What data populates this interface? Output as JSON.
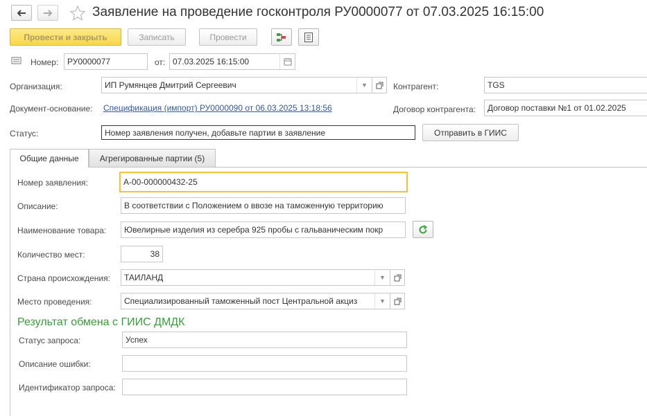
{
  "window": {
    "title": "Заявление на проведение госконтроля РУ0000077 от 07.03.2025 16:15:00"
  },
  "toolbar": {
    "post_close_label": "Провести и закрыть",
    "save_label": "Записать",
    "post_label": "Провести"
  },
  "header": {
    "number_label": "Номер:",
    "number_value": "РУ0000077",
    "date_label": "от:",
    "date_value": "07.03.2025 16:15:00",
    "org_label": "Организация:",
    "org_value": "ИП Румянцев Дмитрий Сергеевич",
    "contractor_label": "Контрагент:",
    "contractor_value": "TGS",
    "basis_label": "Документ-основание:",
    "basis_link": "Спецификация (импорт) РУ0000090 от 06.03.2025 13:18:56",
    "contract_label": "Договор контрагента:",
    "contract_value": "Договор поставки №1 от 01.02.2025",
    "status_label": "Статус:",
    "status_value": "Номер заявления получен, добавьте партии в заявление",
    "send_gis_label": "Отправить в ГИИС"
  },
  "tabs": [
    {
      "label": "Общие данные",
      "active": true
    },
    {
      "label": "Агрегированные партии (5)",
      "active": false
    }
  ],
  "general": {
    "app_number_label": "Номер заявления:",
    "app_number_value": "А-00-000000432-25",
    "description_label": "Описание:",
    "description_value": "В соответствии с Положением о ввозе на таможенную территорию",
    "goods_label": "Наименование товара:",
    "goods_value": "Ювелирные изделия из серебра 925 пробы с гальваническим покр",
    "places_label": "Количество мест:",
    "places_value": "38",
    "country_label": "Страна происхождения:",
    "country_value": "ТАИЛАНД",
    "location_label": "Место проведения:",
    "location_value": "Специализированный таможенный пост Центральной акциз"
  },
  "result": {
    "title": "Результат обмена с ГИИС ДМДК",
    "req_status_label": "Статус запроса:",
    "req_status_value": "Успех",
    "error_label": "Описание ошибки:",
    "error_value": "",
    "req_id_label": "Идентификатор запроса:",
    "req_id_value": ""
  },
  "colors": {
    "primary_button": "#f7d64a",
    "link": "#2e58a6",
    "section_title": "#3c9b3c",
    "focus_border": "#f0c23a",
    "refresh_icon": "#3aa43a"
  },
  "icons": [
    "arrow-left-icon",
    "arrow-right-icon",
    "star-icon",
    "structure-icon",
    "report-icon",
    "document-icon",
    "calendar-icon",
    "open-icon",
    "refresh-icon",
    "chevron-down-icon"
  ]
}
